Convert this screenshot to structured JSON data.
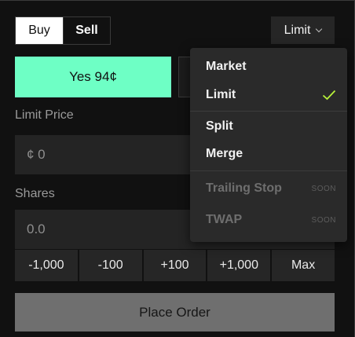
{
  "side_toggle": {
    "buy": "Buy",
    "sell": "Sell"
  },
  "order_type": {
    "selected": "Limit"
  },
  "outcomes": {
    "yes": "Yes 94¢"
  },
  "limit_price": {
    "label": "Limit Price",
    "value": "¢ 0"
  },
  "shares": {
    "label": "Shares",
    "value": "0.0"
  },
  "quick_amounts": [
    "-1,000",
    "-100",
    "+100",
    "+1,000",
    "Max"
  ],
  "place_order": "Place Order",
  "dropdown": {
    "items": [
      {
        "label": "Market"
      },
      {
        "label": "Limit",
        "checked": true
      },
      {
        "label": "Split"
      },
      {
        "label": "Merge"
      },
      {
        "label": "Trailing Stop",
        "badge": "SOON"
      },
      {
        "label": "TWAP",
        "badge": "SOON"
      }
    ]
  },
  "colors": {
    "accent_green": "#6effc5",
    "check_green": "#b8f23a"
  }
}
